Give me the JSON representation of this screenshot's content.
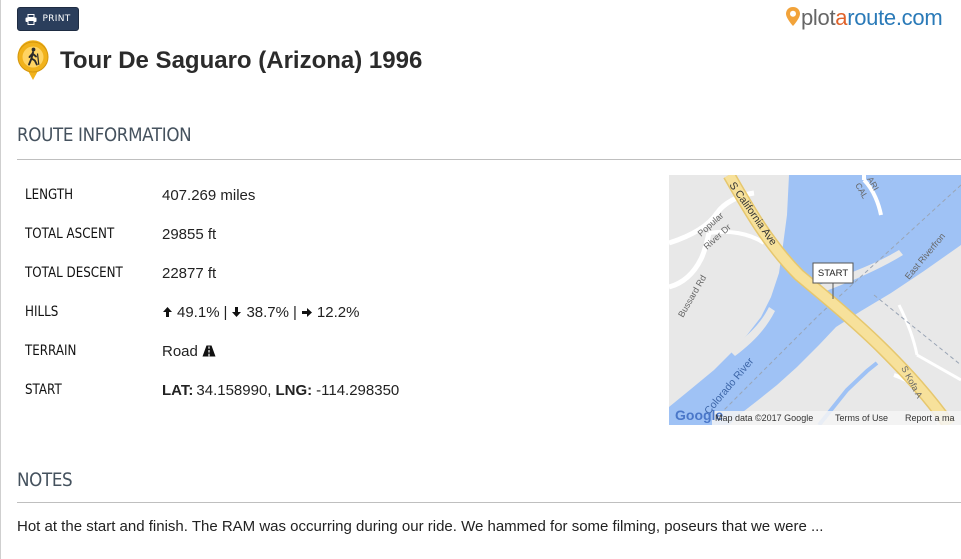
{
  "header": {
    "print_label": "PRINT",
    "logo": {
      "part1": "plot",
      "part2": "a",
      "part3": "route",
      "part4": ".com"
    },
    "title": "Tour De Saguaro (Arizona) 1996"
  },
  "route_info": {
    "heading": "ROUTE INFORMATION",
    "rows": [
      {
        "label": "LENGTH",
        "value": "407.269 miles"
      },
      {
        "label": "TOTAL ASCENT",
        "value": "29855 ft"
      },
      {
        "label": "TOTAL DESCENT",
        "value": "22877 ft"
      },
      {
        "label": "HILLS",
        "up": "49.1%",
        "down": "38.7%",
        "flat": "12.2%",
        "sep": "|"
      },
      {
        "label": "TERRAIN",
        "value": "Road"
      },
      {
        "label": "START",
        "lat_label": "LAT:",
        "lat": "34.158990",
        "sep": ",",
        "lng_label": "LNG:",
        "lng": "-114.298350"
      }
    ]
  },
  "map": {
    "labels": {
      "street": "S California Ave",
      "river": "Colorado River",
      "popular": "Popular",
      "river_dr": "River Dr",
      "bussard": "Bussard Rd",
      "riverfront": "East Riverfron",
      "cal1": "CAL",
      "cal2": "ARI",
      "kofa": "S Kofa A",
      "start_marker": "START"
    },
    "attribution": {
      "google": "Google",
      "data": "Map data ©2017 Google",
      "terms": "Terms of Use",
      "report": "Report a ma"
    },
    "colors": {
      "water": "#9fc2f5",
      "land": "#e8e8e8",
      "road": "#f7e19b",
      "road_outline": "#e6c76e"
    }
  },
  "notes": {
    "heading": "NOTES",
    "text": "Hot at the start and finish. The RAM was occurring during our ride. We hammed for some filming, poseurs that we were ..."
  },
  "icons": {
    "print": "printer-icon",
    "hiker": "hiker-pin-icon",
    "arrows": [
      "arrow-up-icon",
      "arrow-down-icon",
      "arrow-right-icon"
    ],
    "road": "road-icon"
  }
}
